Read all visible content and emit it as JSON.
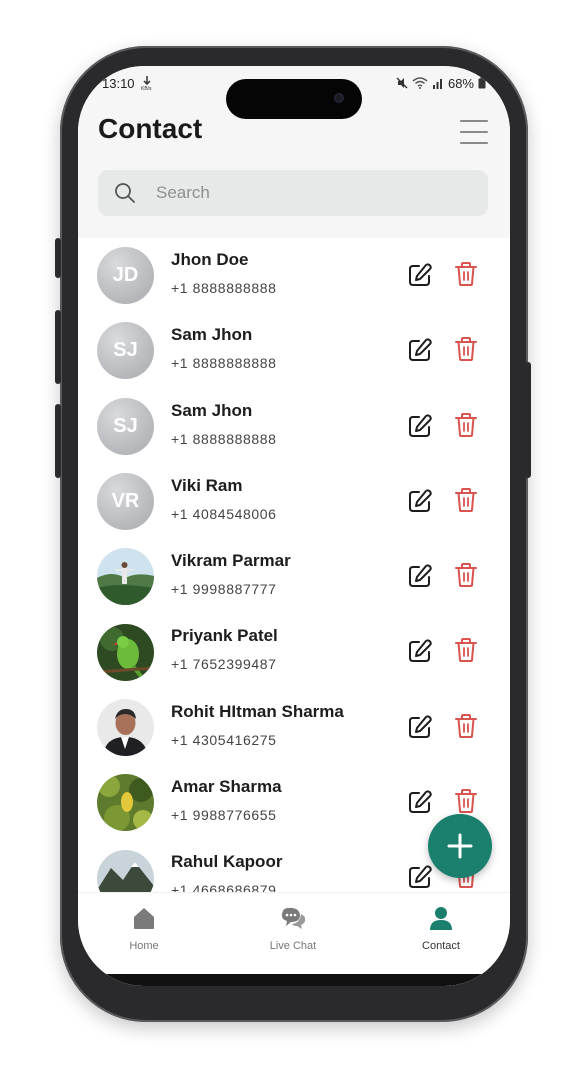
{
  "status_bar": {
    "time": "13:10",
    "battery": "68%"
  },
  "header": {
    "title": "Contact"
  },
  "search": {
    "placeholder": "Search",
    "value": ""
  },
  "contacts": [
    {
      "name": "Jhon Doe",
      "phone": "+1 8888888888",
      "initials": "JD",
      "avatar": "initials"
    },
    {
      "name": "Sam Jhon",
      "phone": "+1 8888888888",
      "initials": "SJ",
      "avatar": "initials"
    },
    {
      "name": "Sam Jhon",
      "phone": "+1 8888888888",
      "initials": "SJ",
      "avatar": "initials"
    },
    {
      "name": "Viki Ram",
      "phone": "+1 4084548006",
      "initials": "VR",
      "avatar": "initials"
    },
    {
      "name": "Vikram Parmar",
      "phone": "+1 9998887777",
      "initials": "",
      "avatar": "photo-landscape"
    },
    {
      "name": "Priyank Patel",
      "phone": "+1 7652399487",
      "initials": "",
      "avatar": "photo-parrot"
    },
    {
      "name": "Rohit HItman Sharma",
      "phone": "+1 4305416275",
      "initials": "",
      "avatar": "photo-man"
    },
    {
      "name": "Amar Sharma",
      "phone": "+1 9988776655",
      "initials": "",
      "avatar": "photo-leaves"
    },
    {
      "name": "Rahul Kapoor",
      "phone": "+1 4668686879",
      "initials": "",
      "avatar": "photo-mountain"
    }
  ],
  "bottom_nav": [
    {
      "label": "Home",
      "icon": "home-icon",
      "active": false
    },
    {
      "label": "Live Chat",
      "icon": "chat-icon",
      "active": false
    },
    {
      "label": "Contact",
      "icon": "person-icon",
      "active": true
    }
  ],
  "colors": {
    "accent": "#1a7f6d",
    "delete": "#d9534f",
    "avatar_bg": "#b5b7bb"
  }
}
